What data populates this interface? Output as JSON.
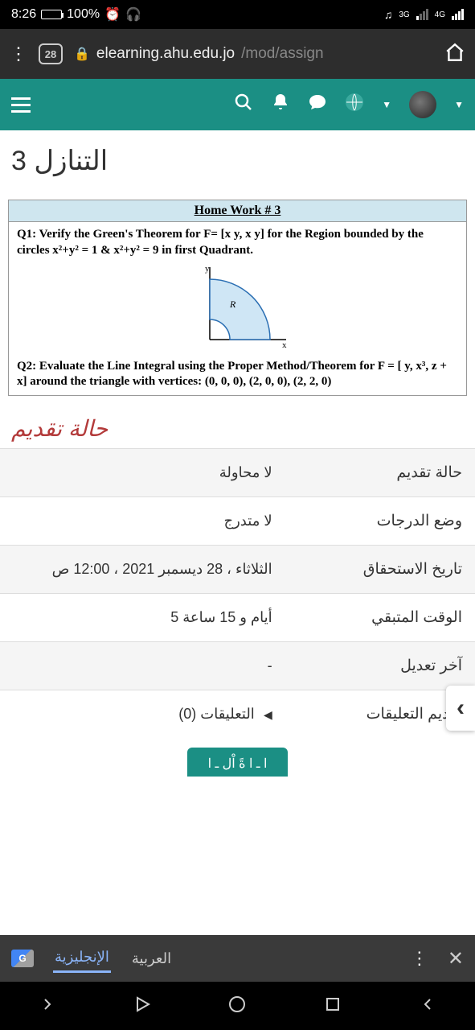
{
  "status": {
    "time": "8:26",
    "battery_pct": "100%",
    "net_label_1": "3G",
    "net_label_2": "4G"
  },
  "browser": {
    "tab_count": "28",
    "url_host": "elearning.ahu.edu.jo",
    "url_path": "/mod/assign"
  },
  "page": {
    "title": "التنازل 3"
  },
  "homework": {
    "header": "Home Work # 3",
    "q1": "Q1: Verify the Green's Theorem for F= [x y, x y] for the Region bounded by the circles x²+y² = 1 & x²+y² = 9 in first Quadrant.",
    "q2": "Q2: Evaluate the Line Integral using the Proper Method/Theorem for F = [ y, x³, z + x] around the triangle with vertices: (0, 0, 0), (2, 0, 0), (2, 2, 0)",
    "axis_y": "y",
    "axis_x": "x",
    "region_label": "R"
  },
  "submission": {
    "section_title": "حالة تقديم",
    "rows": {
      "status_label": "حالة تقديم",
      "status_value": "لا محاولة",
      "grade_label": "وضع الدرجات",
      "grade_value": "لا متدرج",
      "due_label": "تاريخ الاستحقاق",
      "due_value": "الثلاثاء ، 28 ديسمبر 2021 ، 12:00 ص",
      "remaining_label": "الوقت المتبقي",
      "remaining_value": "أيام و 15 ساعة 5",
      "modified_label": "آخر تعديل",
      "modified_value": "-",
      "comments_label": "تقديم التعليقات",
      "comments_value": "التعليقات (0)"
    },
    "button_partial": "ا ـ ا ةً اْل ـ ا"
  },
  "translate": {
    "lang_en": "الإنجليزية",
    "lang_ar": "العربية"
  }
}
